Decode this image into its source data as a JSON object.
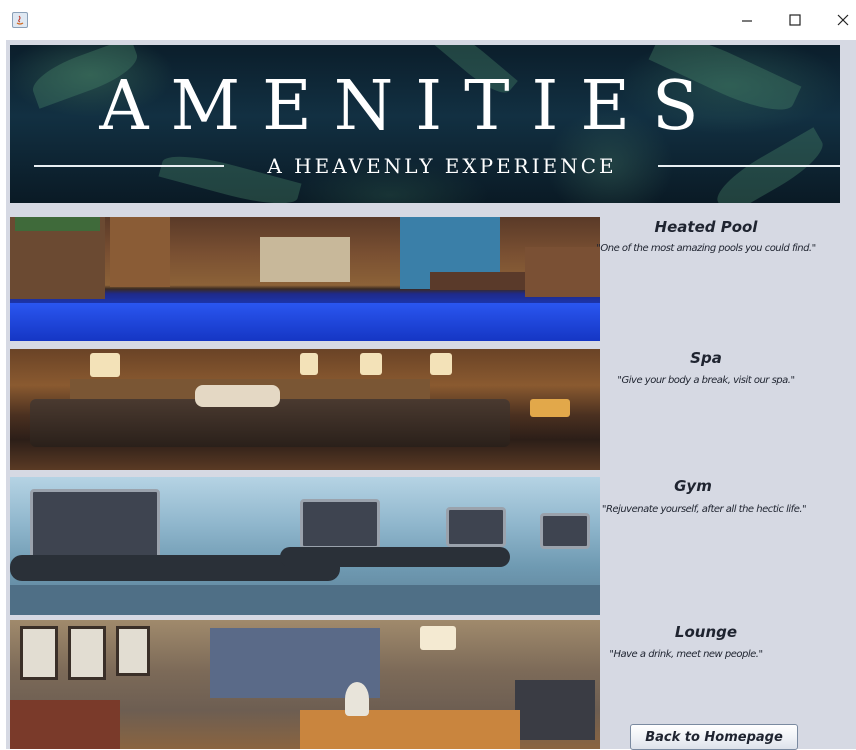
{
  "window": {
    "minimize_icon": "minimize-icon",
    "maximize_icon": "maximize-icon",
    "close_icon": "close-icon"
  },
  "banner": {
    "title": "AMENITIES",
    "subtitle": "A HEAVENLY EXPERIENCE"
  },
  "amenities": [
    {
      "name": "Heated Pool",
      "description": "\"One of the most amazing pools you could find.\""
    },
    {
      "name": "Spa",
      "description": "\"Give your body a break, visit our spa.\""
    },
    {
      "name": "Gym",
      "description": "\"Rejuvenate yourself, after all the hectic life.\""
    },
    {
      "name": "Lounge",
      "description": "\"Have a drink, meet new people.\""
    }
  ],
  "back_button": {
    "label": "Back to Homepage"
  },
  "colors": {
    "panel_background": "#d6d9e3",
    "text": "#1f2430",
    "pool_water": "#1a44d8"
  }
}
